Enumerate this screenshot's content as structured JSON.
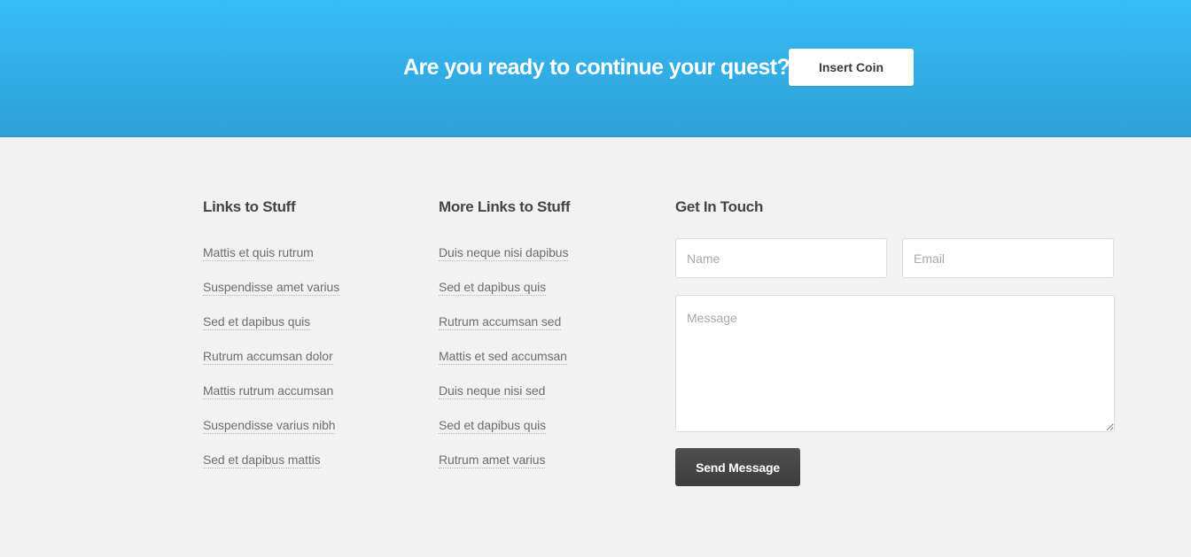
{
  "cta": {
    "title": "Are you ready to continue your quest?",
    "button_label": "Insert Coin"
  },
  "footer": {
    "columns": [
      {
        "heading": "Links to Stuff",
        "links": [
          "Mattis et quis rutrum",
          "Suspendisse amet varius",
          "Sed et dapibus quis",
          "Rutrum accumsan dolor",
          "Mattis rutrum accumsan",
          "Suspendisse varius nibh",
          "Sed et dapibus mattis"
        ]
      },
      {
        "heading": "More Links to Stuff",
        "links": [
          "Duis neque nisi dapibus",
          "Sed et dapibus quis",
          "Rutrum accumsan sed",
          "Mattis et sed accumsan",
          "Duis neque nisi sed",
          "Sed et dapibus quis",
          "Rutrum amet varius"
        ]
      }
    ],
    "contact": {
      "heading": "Get In Touch",
      "name_placeholder": "Name",
      "email_placeholder": "Email",
      "message_placeholder": "Message",
      "send_label": "Send Message"
    }
  },
  "colors": {
    "cta_gradient_top": "#37bdf6",
    "cta_gradient_bottom": "#2e9fd6",
    "footer_bg": "#f2f2f2",
    "send_button": "#474747"
  }
}
